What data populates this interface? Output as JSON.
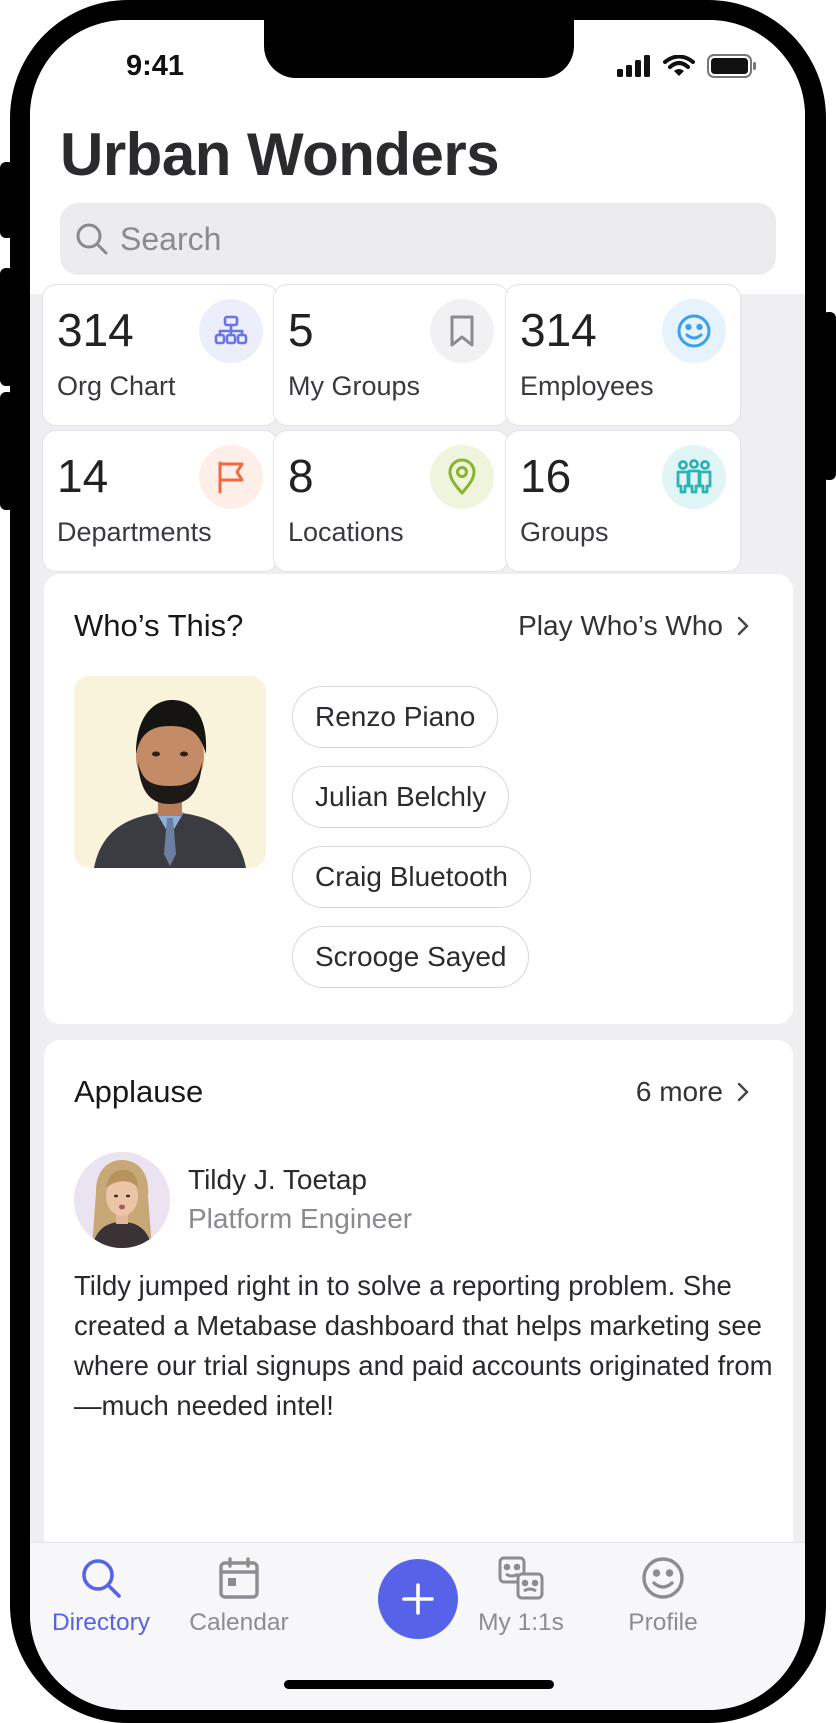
{
  "status_bar": {
    "time": "9:41"
  },
  "header": {
    "title": "Urban Wonders"
  },
  "search": {
    "placeholder": "Search"
  },
  "stats": [
    {
      "value": "314",
      "label": "Org Chart",
      "icon": "org-chart-icon",
      "color": "#6b74e6"
    },
    {
      "value": "5",
      "label": "My Groups",
      "icon": "bookmark-icon",
      "color": "#8a8a90"
    },
    {
      "value": "314",
      "label": "Employees",
      "icon": "smiley-icon",
      "color": "#3aa0e8"
    },
    {
      "value": "14",
      "label": "Departments",
      "icon": "flag-icon",
      "color": "#ef6a44"
    },
    {
      "value": "8",
      "label": "Locations",
      "icon": "location-pin-icon",
      "color": "#8ab32e"
    },
    {
      "value": "16",
      "label": "Groups",
      "icon": "people-group-icon",
      "color": "#2bb3b5"
    }
  ],
  "whos_this": {
    "title": "Who’s This?",
    "link_label": "Play Who’s Who",
    "options": [
      "Renzo Piano",
      "Julian Belchly",
      "Craig Bluetooth",
      "Scrooge Sayed"
    ]
  },
  "applause": {
    "title": "Applause",
    "link_label": "6 more",
    "name": "Tildy J. Toetap",
    "role": "Platform Engineer",
    "body": "Tildy jumped right in to solve a reporting problem. She created a Metabase dashboard that helps marketing see where our trial signups and paid accounts originated from—much needed intel!"
  },
  "tabbar": {
    "directory": "Directory",
    "calendar": "Calendar",
    "my11s": "My 1:1s",
    "profile": "Profile",
    "active": "Directory",
    "accent": "#5663e8"
  }
}
